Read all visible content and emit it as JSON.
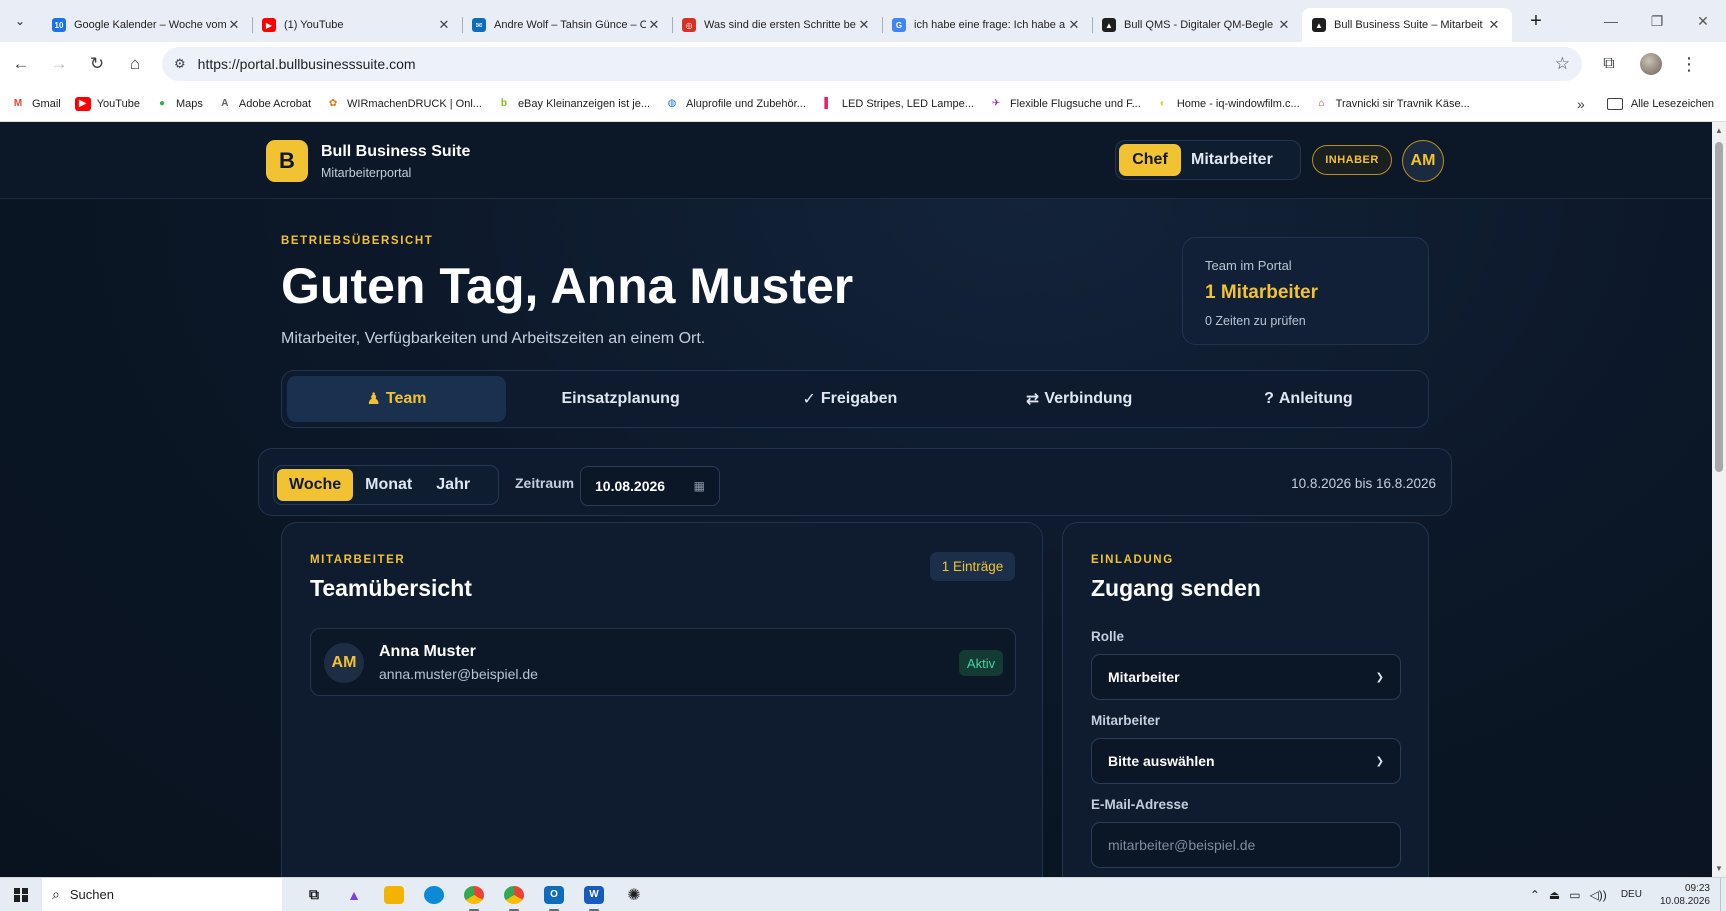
{
  "browser": {
    "tabs": [
      {
        "title": "Google Kalender – Woche vom",
        "favicon_text": "10",
        "favicon_color": "#1a73e8"
      },
      {
        "title": "(1) YouTube",
        "favicon_text": "▶",
        "favicon_color": "#ff0000"
      },
      {
        "title": "Andre Wolf – Tahsin Günce – O",
        "favicon_text": "✉",
        "favicon_color": "#0f6cbd"
      },
      {
        "title": "Was sind die ersten Schritte be",
        "favicon_text": "◎",
        "favicon_color": "#d93025"
      },
      {
        "title": "ich habe eine frage: Ich habe a",
        "favicon_text": "G",
        "favicon_color": "#4285f4"
      },
      {
        "title": "Bull QMS - Digitaler QM-Begle",
        "favicon_text": "▲",
        "favicon_color": "#1f1f1f"
      },
      {
        "title": "Bull Business Suite – Mitarbeit",
        "favicon_text": "▲",
        "favicon_color": "#1f1f1f"
      }
    ],
    "url": "https://portal.bullbusinesssuite.com",
    "bookmarks": [
      {
        "label": "Gmail",
        "icon": "M",
        "color": "#ea4335"
      },
      {
        "label": "YouTube",
        "icon": "▶",
        "color": "#ff0000"
      },
      {
        "label": "Maps",
        "icon": "●",
        "color": "#34a853"
      },
      {
        "label": "Adobe Acrobat",
        "icon": "A",
        "color": "#5f6368"
      },
      {
        "label": "WIRmachenDRUCK | Onl...",
        "icon": "✿",
        "color": "#e8710a"
      },
      {
        "label": "eBay Kleinanzeigen ist je...",
        "icon": "b",
        "color": "#86b817"
      },
      {
        "label": "Aluprofile und Zubehör...",
        "icon": "◍",
        "color": "#1a73e8"
      },
      {
        "label": "LED Stripes, LED Lampe...",
        "icon": "▌",
        "color": "#e91e63"
      },
      {
        "label": "Flexible Flugsuche und F...",
        "icon": "✈",
        "color": "#9c27b0"
      },
      {
        "label": "Home - iq-windowfilm.c...",
        "icon": "◐",
        "color": "#f4c20d"
      },
      {
        "label": "Travnicki sir Travnik Käse...",
        "icon": "⌂",
        "color": "#c62828"
      }
    ],
    "all_bookmarks_label": "Alle Lesezeichen"
  },
  "app": {
    "brand_initial": "B",
    "brand_title": "Bull Business Suite",
    "brand_subtitle": "Mitarbeiterportal",
    "role_options": [
      "Chef",
      "Mitarbeiter"
    ],
    "active_role": "Chef",
    "owner_badge": "INHABER",
    "user_initials": "AM",
    "kicker": "BETRIEBSÜBERSICHT",
    "greeting": "Guten Tag, Anna Muster",
    "subtitle": "Mitarbeiter, Verfügbarkeiten und Arbeitszeiten an einem Ort.",
    "stat": {
      "label": "Team im Portal",
      "value": "1 Mitarbeiter",
      "note": "0 Zeiten zu prüfen"
    },
    "main_tabs": [
      {
        "icon": "♟",
        "label": "Team"
      },
      {
        "icon": "",
        "label": "Einsatzplanung"
      },
      {
        "icon": "✓",
        "label": "Freigaben"
      },
      {
        "icon": "⇄",
        "label": "Verbindung"
      },
      {
        "icon": "?",
        "label": "Anleitung"
      }
    ],
    "period_options": [
      "Woche",
      "Monat",
      "Jahr"
    ],
    "active_period": "Woche",
    "zeitraum_label": "Zeitraum",
    "date_value": "10.08.2026",
    "range_text": "10.8.2026 bis 16.8.2026",
    "team_card": {
      "kicker": "MITARBEITER",
      "title": "Teamübersicht",
      "count_badge": "1 Einträge",
      "members": [
        {
          "initials": "AM",
          "name": "Anna Muster",
          "email": "anna.muster@beispiel.de",
          "status": "Aktiv"
        }
      ]
    },
    "invite_card": {
      "kicker": "EINLADUNG",
      "title": "Zugang senden",
      "role_label": "Rolle",
      "role_value": "Mitarbeiter",
      "employee_label": "Mitarbeiter",
      "employee_value": "Bitte auswählen",
      "email_label": "E-Mail-Adresse",
      "email_placeholder": "mitarbeiter@beispiel.de"
    }
  },
  "taskbar": {
    "search_label": "Suchen",
    "language": "DEU",
    "time": "09:23",
    "date": "10.08.2026"
  }
}
